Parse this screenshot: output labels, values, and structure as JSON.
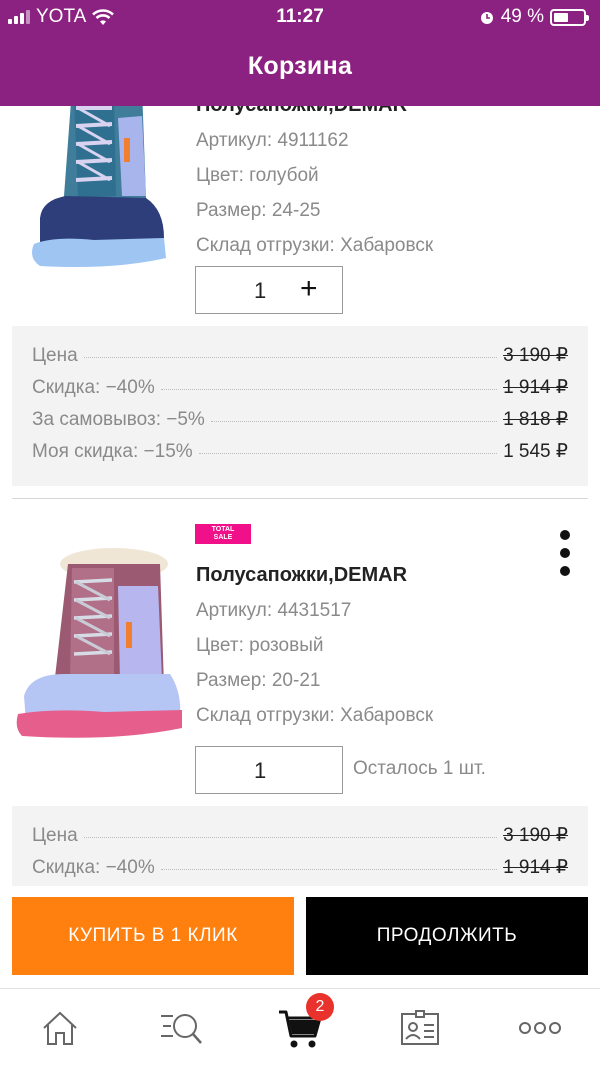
{
  "status": {
    "carrier": "YOTA",
    "time": "11:27",
    "battery": "49 %"
  },
  "header": {
    "title": "Корзина"
  },
  "item1": {
    "name": "Полусапожки,DEMAR",
    "article": "Артикул: 4911162",
    "color": "Цвет: голубой",
    "size": "Размер: 24-25",
    "warehouse": "Склад отгрузки: Хабаровск",
    "qty": "1",
    "plus": "+",
    "prices": [
      {
        "label": "Цена",
        "value": "3 190 ₽"
      },
      {
        "label": "Скидка: −40%",
        "value": "1 914 ₽"
      },
      {
        "label": "За самовывоз: −5%",
        "value": "1 818 ₽"
      },
      {
        "label": "Моя скидка: −15%",
        "value": "1 545 ₽"
      }
    ]
  },
  "item2": {
    "badge_top": "TOTAL",
    "badge_bottom": "SALE",
    "name": "Полусапожки,DEMAR",
    "article": "Артикул: 4431517",
    "color": "Цвет: розовый",
    "size": "Размер: 20-21",
    "warehouse": "Склад отгрузки: Хабаровск",
    "qty": "1",
    "stock": "Осталось 1 шт.",
    "prices": [
      {
        "label": "Цена",
        "value": "3 190 ₽"
      },
      {
        "label": "Скидка: −40%",
        "value": "1 914 ₽"
      }
    ]
  },
  "actions": {
    "buy_one_click": "КУПИТЬ В 1 КЛИК",
    "continue": "ПРОДОЛЖИТЬ"
  },
  "tabbar": {
    "items": [
      "home-icon",
      "search-icon",
      "cart-icon",
      "profile-card-icon",
      "more-icon"
    ],
    "cart_count": "2"
  },
  "colors": {
    "brand": "#8b2180",
    "accent": "#ff7f0f",
    "badge": "#e8322b",
    "sale": "#f0118a"
  }
}
